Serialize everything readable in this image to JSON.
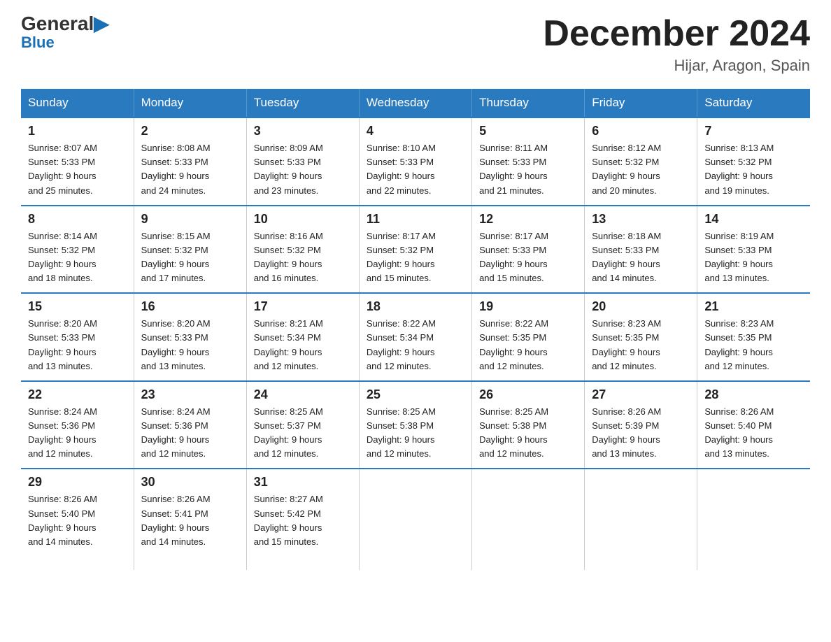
{
  "header": {
    "logo_general": "General",
    "logo_blue": "Blue",
    "month_title": "December 2024",
    "location": "Hijar, Aragon, Spain"
  },
  "weekdays": [
    "Sunday",
    "Monday",
    "Tuesday",
    "Wednesday",
    "Thursday",
    "Friday",
    "Saturday"
  ],
  "weeks": [
    [
      {
        "day": "1",
        "sunrise": "8:07 AM",
        "sunset": "5:33 PM",
        "daylight": "9 hours and 25 minutes."
      },
      {
        "day": "2",
        "sunrise": "8:08 AM",
        "sunset": "5:33 PM",
        "daylight": "9 hours and 24 minutes."
      },
      {
        "day": "3",
        "sunrise": "8:09 AM",
        "sunset": "5:33 PM",
        "daylight": "9 hours and 23 minutes."
      },
      {
        "day": "4",
        "sunrise": "8:10 AM",
        "sunset": "5:33 PM",
        "daylight": "9 hours and 22 minutes."
      },
      {
        "day": "5",
        "sunrise": "8:11 AM",
        "sunset": "5:33 PM",
        "daylight": "9 hours and 21 minutes."
      },
      {
        "day": "6",
        "sunrise": "8:12 AM",
        "sunset": "5:32 PM",
        "daylight": "9 hours and 20 minutes."
      },
      {
        "day": "7",
        "sunrise": "8:13 AM",
        "sunset": "5:32 PM",
        "daylight": "9 hours and 19 minutes."
      }
    ],
    [
      {
        "day": "8",
        "sunrise": "8:14 AM",
        "sunset": "5:32 PM",
        "daylight": "9 hours and 18 minutes."
      },
      {
        "day": "9",
        "sunrise": "8:15 AM",
        "sunset": "5:32 PM",
        "daylight": "9 hours and 17 minutes."
      },
      {
        "day": "10",
        "sunrise": "8:16 AM",
        "sunset": "5:32 PM",
        "daylight": "9 hours and 16 minutes."
      },
      {
        "day": "11",
        "sunrise": "8:17 AM",
        "sunset": "5:32 PM",
        "daylight": "9 hours and 15 minutes."
      },
      {
        "day": "12",
        "sunrise": "8:17 AM",
        "sunset": "5:33 PM",
        "daylight": "9 hours and 15 minutes."
      },
      {
        "day": "13",
        "sunrise": "8:18 AM",
        "sunset": "5:33 PM",
        "daylight": "9 hours and 14 minutes."
      },
      {
        "day": "14",
        "sunrise": "8:19 AM",
        "sunset": "5:33 PM",
        "daylight": "9 hours and 13 minutes."
      }
    ],
    [
      {
        "day": "15",
        "sunrise": "8:20 AM",
        "sunset": "5:33 PM",
        "daylight": "9 hours and 13 minutes."
      },
      {
        "day": "16",
        "sunrise": "8:20 AM",
        "sunset": "5:33 PM",
        "daylight": "9 hours and 13 minutes."
      },
      {
        "day": "17",
        "sunrise": "8:21 AM",
        "sunset": "5:34 PM",
        "daylight": "9 hours and 12 minutes."
      },
      {
        "day": "18",
        "sunrise": "8:22 AM",
        "sunset": "5:34 PM",
        "daylight": "9 hours and 12 minutes."
      },
      {
        "day": "19",
        "sunrise": "8:22 AM",
        "sunset": "5:35 PM",
        "daylight": "9 hours and 12 minutes."
      },
      {
        "day": "20",
        "sunrise": "8:23 AM",
        "sunset": "5:35 PM",
        "daylight": "9 hours and 12 minutes."
      },
      {
        "day": "21",
        "sunrise": "8:23 AM",
        "sunset": "5:35 PM",
        "daylight": "9 hours and 12 minutes."
      }
    ],
    [
      {
        "day": "22",
        "sunrise": "8:24 AM",
        "sunset": "5:36 PM",
        "daylight": "9 hours and 12 minutes."
      },
      {
        "day": "23",
        "sunrise": "8:24 AM",
        "sunset": "5:36 PM",
        "daylight": "9 hours and 12 minutes."
      },
      {
        "day": "24",
        "sunrise": "8:25 AM",
        "sunset": "5:37 PM",
        "daylight": "9 hours and 12 minutes."
      },
      {
        "day": "25",
        "sunrise": "8:25 AM",
        "sunset": "5:38 PM",
        "daylight": "9 hours and 12 minutes."
      },
      {
        "day": "26",
        "sunrise": "8:25 AM",
        "sunset": "5:38 PM",
        "daylight": "9 hours and 12 minutes."
      },
      {
        "day": "27",
        "sunrise": "8:26 AM",
        "sunset": "5:39 PM",
        "daylight": "9 hours and 13 minutes."
      },
      {
        "day": "28",
        "sunrise": "8:26 AM",
        "sunset": "5:40 PM",
        "daylight": "9 hours and 13 minutes."
      }
    ],
    [
      {
        "day": "29",
        "sunrise": "8:26 AM",
        "sunset": "5:40 PM",
        "daylight": "9 hours and 14 minutes."
      },
      {
        "day": "30",
        "sunrise": "8:26 AM",
        "sunset": "5:41 PM",
        "daylight": "9 hours and 14 minutes."
      },
      {
        "day": "31",
        "sunrise": "8:27 AM",
        "sunset": "5:42 PM",
        "daylight": "9 hours and 15 minutes."
      },
      null,
      null,
      null,
      null
    ]
  ],
  "labels": {
    "sunrise": "Sunrise:",
    "sunset": "Sunset:",
    "daylight": "Daylight:"
  }
}
